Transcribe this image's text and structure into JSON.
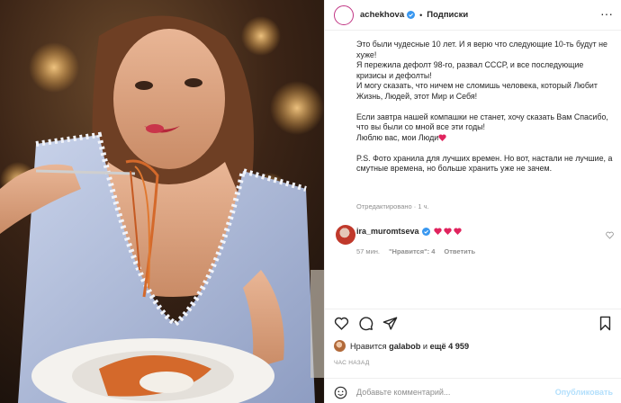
{
  "post": {
    "username": "achekhova",
    "follow_label": "Подписки",
    "separator": "•",
    "caption_paragraphs": [
      "Это были чудесные 10 лет. И я верю что следующие 10-ть будут не хуже!\nЯ пережила дефолт 98-го, развал СССР, и все последующие кризисы и дефолты!\nИ могу сказать, что ничем не сломишь человека, который Любит Жизнь, Людей, этот Мир и Себя!",
      "Если завтра нашей компашки не станет, хочу сказать Вам Спасибо, что вы были со мной все эти годы!\nЛюблю вас, мои Люди",
      "P.S. Фото хранила для лучших времен. Но вот, настали не лучшие, а смутные времена, но больше хранить уже не зачем."
    ],
    "edited_label": "Отредактировано · 1 ч."
  },
  "comment": {
    "username": "ira_muromtseva",
    "time": "57 мин.",
    "likes": "\"Нравится\": 4",
    "reply_label": "Ответить"
  },
  "likes": {
    "prefix": "Нравится",
    "user": "galabob",
    "connector": "и",
    "more": "ещё 4 959"
  },
  "time_ago": "ЧАС НАЗАД",
  "add_comment": {
    "placeholder": "Добавьте комментарий...",
    "publish_label": "Опубликовать"
  },
  "colors": {
    "heart_red": "#ed4956",
    "verified_blue": "#3897f0",
    "publish_disabled": "#b2dffc",
    "muted": "#8e8e8e"
  },
  "icons": [
    "more-icon",
    "verified-icon",
    "heart-icon",
    "comment-icon",
    "share-icon",
    "bookmark-icon",
    "emoji-icon"
  ]
}
